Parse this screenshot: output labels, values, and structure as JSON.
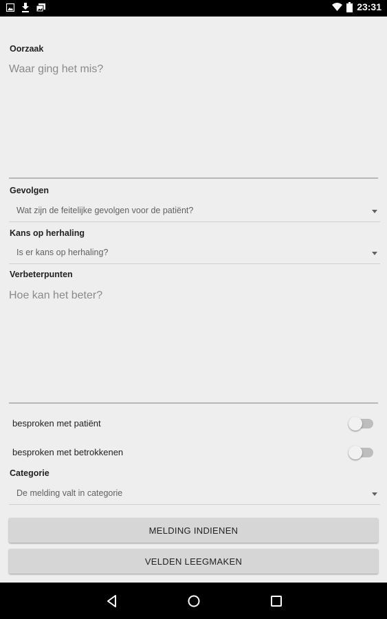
{
  "status_bar": {
    "time": "23:31",
    "left_icons": [
      "image-icon",
      "download-icon",
      "gallery-icon"
    ],
    "right_icons": [
      "wifi-icon",
      "battery-icon"
    ]
  },
  "form": {
    "oorzaak": {
      "label": "Oorzaak",
      "placeholder": "Waar ging het mis?"
    },
    "gevolgen": {
      "label": "Gevolgen",
      "value": "Wat zijn de feitelijke gevolgen voor de patiënt?"
    },
    "herhaling": {
      "label": "Kans op herhaling",
      "value": "Is er kans op herhaling?"
    },
    "verbeterpunten": {
      "label": "Verbeterpunten",
      "placeholder": "Hoe kan het beter?"
    },
    "toggles": [
      {
        "label": "besproken met patiënt",
        "on": false
      },
      {
        "label": "besproken met betrokkenen",
        "on": false
      }
    ],
    "categorie": {
      "label": "Categorie",
      "value": "De melding valt in categorie"
    },
    "submit_label": "MELDING INDIENEN",
    "clear_label": "VELDEN LEEGMAKEN"
  },
  "nav_bar": {
    "icons": [
      "back-icon",
      "home-icon",
      "recents-icon"
    ]
  },
  "colors": {
    "background": "#eeeeee",
    "bars": "#000000",
    "button": "#d6d6d6",
    "placeholder": "#8a8a8a"
  }
}
